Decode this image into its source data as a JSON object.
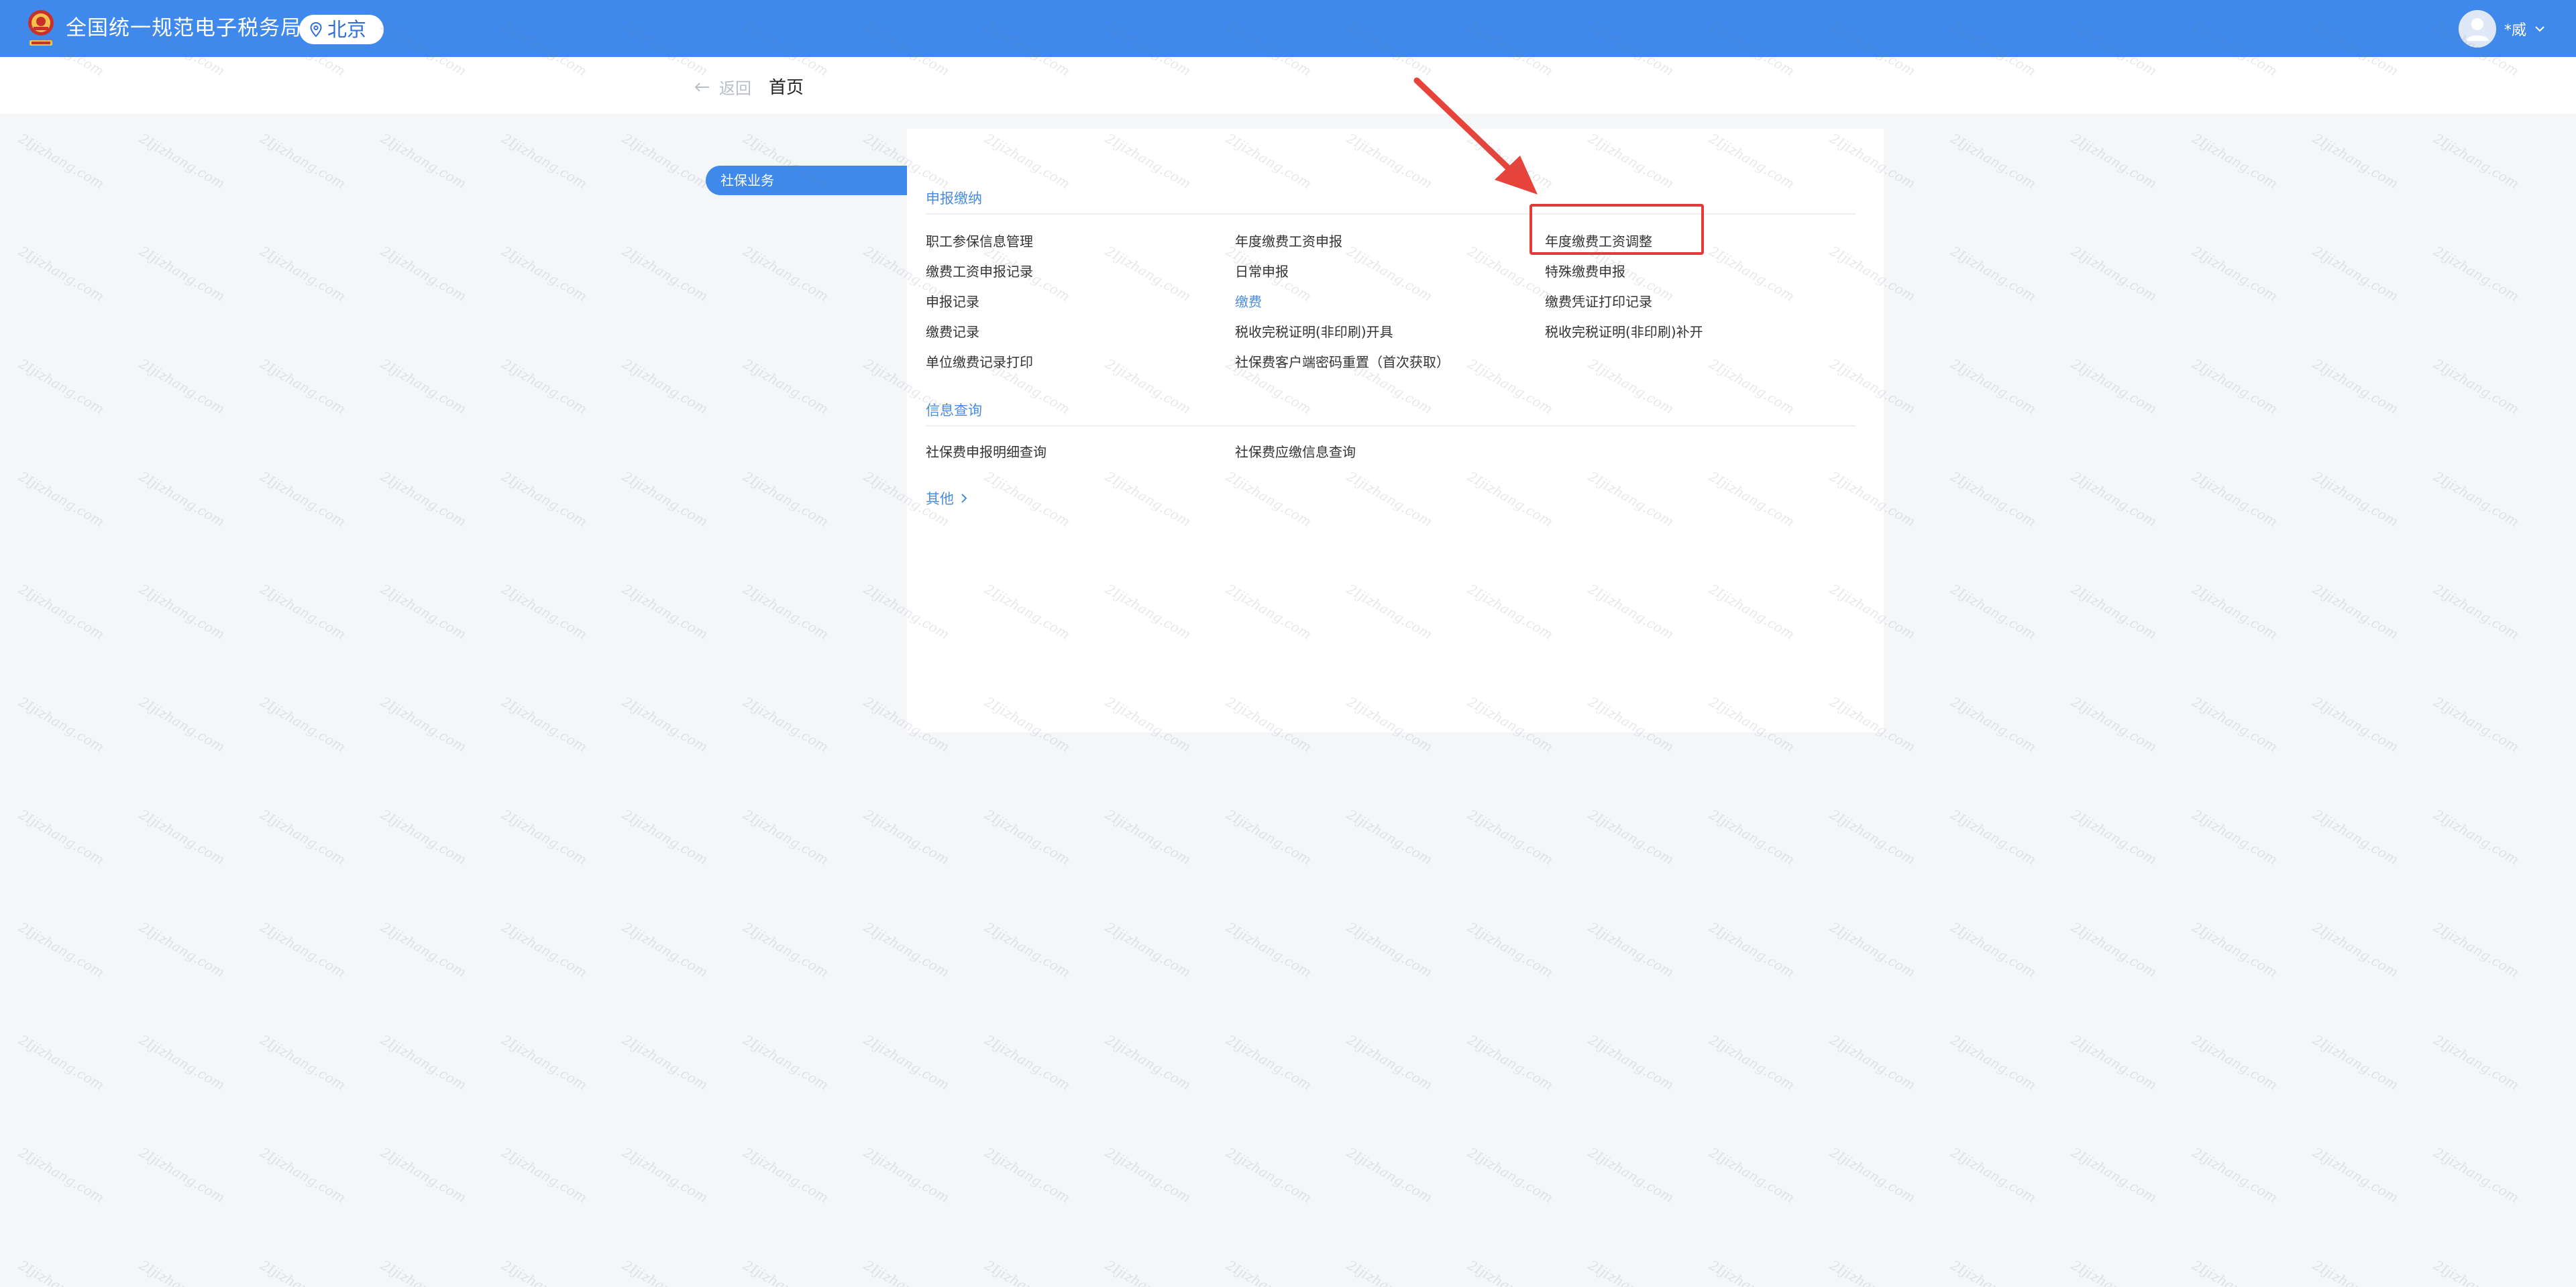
{
  "header": {
    "site_title": "全国统一规范电子税务局",
    "city": "北京",
    "user_name": "*威"
  },
  "subbar": {
    "back_label": "返回",
    "home_label": "首页"
  },
  "sidebar": {
    "active_tab": "社保业务"
  },
  "main": {
    "section_1": {
      "title": "申报缴纳",
      "columns": [
        [
          "职工参保信息管理",
          "缴费工资申报记录",
          "申报记录",
          "缴费记录",
          "单位缴费记录打印"
        ],
        [
          "年度缴费工资申报",
          "日常申报",
          "缴费",
          "税收完税证明(非印刷)开具",
          "社保费客户端密码重置（首次获取）"
        ],
        [
          "年度缴费工资调整",
          "特殊缴费申报",
          "缴费凭证打印记录",
          "税收完税证明(非印刷)补开"
        ]
      ]
    },
    "section_2": {
      "title": "信息查询",
      "items": [
        "社保费申报明细查询",
        "社保费应缴信息查询"
      ]
    },
    "more_label": "其他"
  },
  "watermark_text": "2Ijizhang.com",
  "colors": {
    "header_bg": "#3e89eb",
    "accent": "#4a8de0",
    "annotation": "#e23a3a",
    "page_bg": "#f5f6f8"
  }
}
